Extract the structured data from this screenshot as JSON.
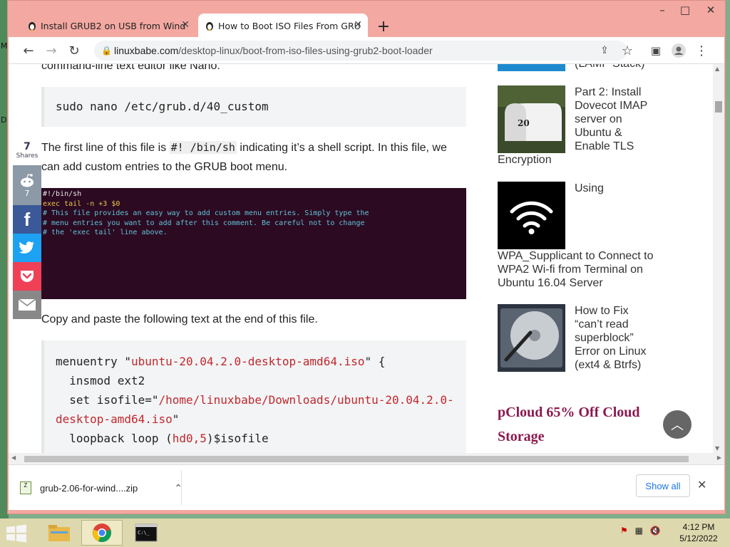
{
  "desktop": {
    "edge_labels": [
      "M",
      "D"
    ]
  },
  "window": {
    "minimize": "–",
    "maximize": "□",
    "close": "✕"
  },
  "tabs": [
    {
      "title": "Install GRUB2 on USB from Wind",
      "favicon": "tux-icon"
    },
    {
      "title": "How to Boot ISO Files From GRU",
      "favicon": "tux-icon",
      "active": true
    }
  ],
  "tab_new": "+",
  "toolbar": {
    "url_domain": "linuxbabe.com",
    "url_path": "/desktop-linux/boot-from-iso-files-using-grub2-boot-loader"
  },
  "article": {
    "top_partial": "command-line text editor like Nano.",
    "code1": "sudo nano /etc/grub.d/40_custom",
    "para1_a": "The first line of this file is ",
    "para1_code": "#! /bin/sh",
    "para1_b": " indicating it’s a shell script. In this file, we",
    "para1_c": "can add custom entries to the GRUB boot menu.",
    "terminal": {
      "l1": "#!/bin/sh",
      "l2": "exec tail -n +3 $0",
      "l3": "# This file provides an easy way to add custom menu entries.  Simply type the",
      "l4": "# menu entries you want to add after this comment.  Be careful not to change",
      "l5": "# the 'exec tail' line above."
    },
    "para2": "Copy and paste the following text at the end of this file.",
    "code2": {
      "l1_a": "menuentry \"",
      "l1_s": "ubuntu-20.04.2.0-desktop-amd64.iso",
      "l1_b": "\" {",
      "l2": "  insmod ext2",
      "l3_a": "  set isofile=\"",
      "l3_s": "/home/linuxbabe/Downloads/ubuntu-20.04.2.0-",
      "l4_s": "desktop-amd64.iso",
      "l4_b": "\"",
      "l5_a": "  loopback loop (",
      "l5_s": "hd0,5",
      "l5_b": ")$isofile"
    }
  },
  "share": {
    "count": "7",
    "label": "Shares",
    "reddit_count": "7"
  },
  "sidebar": {
    "item0_tail": "(LAMP Stack)",
    "item1_lines": [
      "Part 2: Install",
      "Dovecot IMAP",
      "server on",
      "Ubuntu &",
      "Enable TLS"
    ],
    "item1_under": "Encryption",
    "item2_line": "Using",
    "item2_under": [
      "WPA_Supplicant to Connect to",
      "WPA2 Wi-fi from Terminal on",
      "Ubuntu 16.04 Server"
    ],
    "item3_lines": [
      "How to Fix",
      "“can’t read",
      "superblock”",
      "Error on Linux",
      "(ext4 & Btrfs)"
    ],
    "promo": [
      "pCloud 65% Off Cloud",
      "Storage"
    ]
  },
  "download": {
    "filename": "grub-2.06-for-wind....zip",
    "show_all": "Show all"
  },
  "taskbar": {
    "time": "4:12 PM",
    "date": "5/12/2022"
  }
}
